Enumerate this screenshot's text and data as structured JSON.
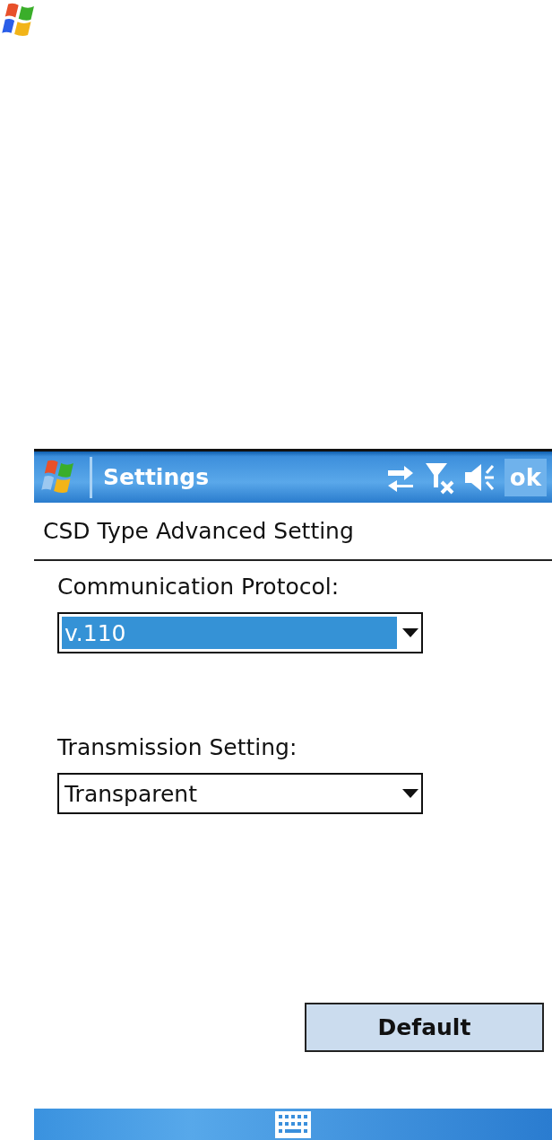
{
  "screen": {
    "title": "Settings",
    "ok_button": "ok",
    "heading": "CSD Type Advanced Setting",
    "fields": [
      {
        "label": "Communication Protocol:",
        "value": "v.110",
        "focused": true
      },
      {
        "label": "Transmission Setting:",
        "value": "Transparent",
        "focused": false
      }
    ],
    "default_button": "Default"
  }
}
